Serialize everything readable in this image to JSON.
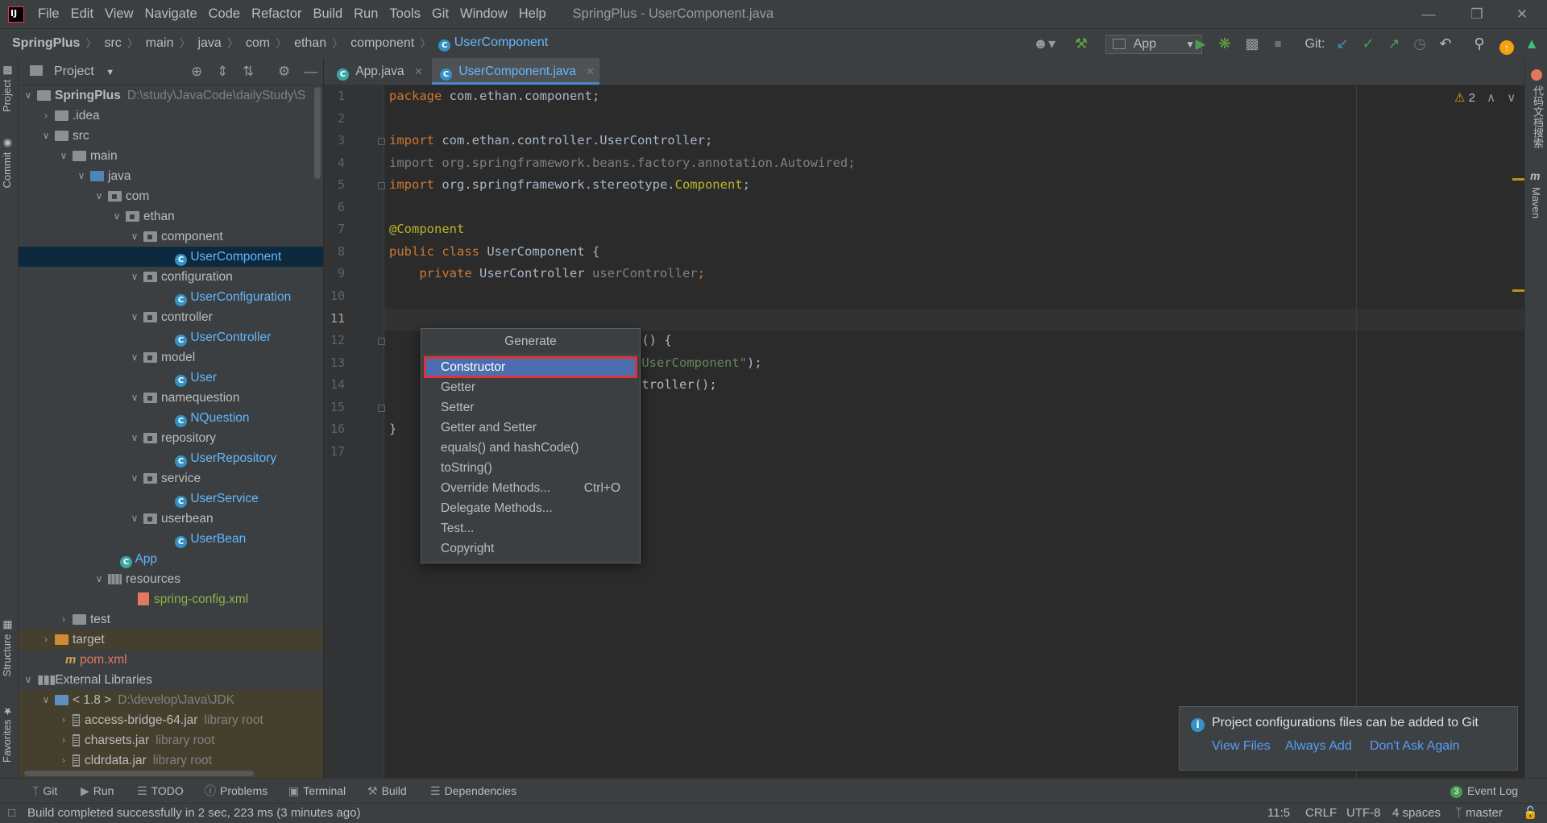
{
  "menu": {
    "items": [
      "File",
      "Edit",
      "View",
      "Navigate",
      "Code",
      "Refactor",
      "Build",
      "Run",
      "Tools",
      "Git",
      "Window",
      "Help"
    ],
    "window_title": "SpringPlus - UserComponent.java"
  },
  "breadcrumb": [
    "SpringPlus",
    "src",
    "main",
    "java",
    "com",
    "ethan",
    "component",
    "UserComponent"
  ],
  "toolbar": {
    "run_config": "App",
    "git_label": "Git:"
  },
  "sidebar_tabs": {
    "left": [
      "Project",
      "Commit",
      "Structure",
      "Favorites"
    ],
    "right": [
      "代码文档搜索",
      "Maven"
    ]
  },
  "project_panel": {
    "title": "Project"
  },
  "tree": [
    {
      "label": "SpringPlus",
      "hint": "D:\\study\\JavaCode\\dailyStudy\\S"
    },
    {
      "label": ".idea"
    },
    {
      "label": "src"
    },
    {
      "label": "main"
    },
    {
      "label": "java"
    },
    {
      "label": "com"
    },
    {
      "label": "ethan"
    },
    {
      "label": "component"
    },
    {
      "label": "UserComponent"
    },
    {
      "label": "configuration"
    },
    {
      "label": "UserConfiguration"
    },
    {
      "label": "controller"
    },
    {
      "label": "UserController"
    },
    {
      "label": "model"
    },
    {
      "label": "User"
    },
    {
      "label": "namequestion"
    },
    {
      "label": "NQuestion"
    },
    {
      "label": "repository"
    },
    {
      "label": "UserRepository"
    },
    {
      "label": "service"
    },
    {
      "label": "UserService"
    },
    {
      "label": "userbean"
    },
    {
      "label": "UserBean"
    },
    {
      "label": "App"
    },
    {
      "label": "resources"
    },
    {
      "label": "spring-config.xml"
    },
    {
      "label": "test"
    },
    {
      "label": "target"
    },
    {
      "label": "pom.xml"
    },
    {
      "label": "External Libraries"
    },
    {
      "label": "< 1.8 >",
      "hint": "D:\\develop\\Java\\JDK"
    },
    {
      "label": "access-bridge-64.jar",
      "hint": "library root"
    },
    {
      "label": "charsets.jar",
      "hint": "library root"
    },
    {
      "label": "cldrdata.jar",
      "hint": "library root"
    }
  ],
  "editor_tabs": [
    "App.java",
    "UserComponent.java"
  ],
  "line_numbers": [
    "1",
    "2",
    "3",
    "4",
    "5",
    "6",
    "7",
    "8",
    "9",
    "10",
    "11",
    "12",
    "13",
    "14",
    "15",
    "16",
    "17"
  ],
  "code": {
    "l1_kw": "package ",
    "l1_rest": "com.ethan.component;",
    "l3_kw": "import ",
    "l3_rest": "com.ethan.controller.UserController;",
    "l4": "import org.springframework.beans.factory.annotation.Autowired;",
    "l5_kw": "import ",
    "l5_rest": "org.springframework.stereotype.",
    "l5_ann": "Component",
    "l5_end": ";",
    "l7": "@Component",
    "l8_kw": "public class ",
    "l8_rest": "UserComponent {",
    "l9_kw": "private ",
    "l9_type": "UserController ",
    "l9_field": "userController",
    "l9_end": ";",
    "l12_tail": "s() {",
    "l13_tail": "\"UserComponent\"",
    "l13_end": ");",
    "l14_tail": "ntroller();",
    "l16": "}"
  },
  "inspection": {
    "warning_count": "2"
  },
  "popup": {
    "title": "Generate",
    "items": [
      "Constructor",
      "Getter",
      "Setter",
      "Getter and Setter",
      "equals() and hashCode()",
      "toString()",
      "Override Methods...",
      "Delegate Methods...",
      "Test...",
      "Copyright"
    ],
    "override_shortcut": "Ctrl+O"
  },
  "notification": {
    "text": "Project configurations files can be added to Git",
    "links": [
      "View Files",
      "Always Add",
      "Don't Ask Again"
    ]
  },
  "tool_windows": [
    "Git",
    "Run",
    "TODO",
    "Problems",
    "Terminal",
    "Build",
    "Dependencies"
  ],
  "event_log": {
    "badge": "3",
    "label": "Event Log"
  },
  "status": {
    "message": "Build completed successfully in 2 sec, 223 ms (3 minutes ago)",
    "position": "11:5",
    "line_sep": "CRLF",
    "encoding": "UTF-8",
    "indent": "4 spaces",
    "branch": "master"
  },
  "colors": {
    "accent": "#4b6eaf",
    "selection_outline": "#e0323a",
    "class_blue": "#62b7ff"
  }
}
